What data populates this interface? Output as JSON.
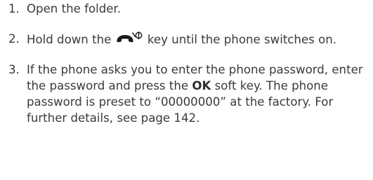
{
  "steps": [
    {
      "number": "1.",
      "text": "Open the folder."
    },
    {
      "number": "2.",
      "before": "Hold down the",
      "icon": "end-power-key-icon",
      "after": "key until the phone switches on."
    },
    {
      "number": "3.",
      "before": "If the phone asks you to enter the phone password, enter the password and press the",
      "bold": "OK",
      "after": "soft key. The phone password is preset to “00000000” at the factory. For further details, see page 142."
    }
  ],
  "colors": {
    "text": "#3a3a3a"
  }
}
